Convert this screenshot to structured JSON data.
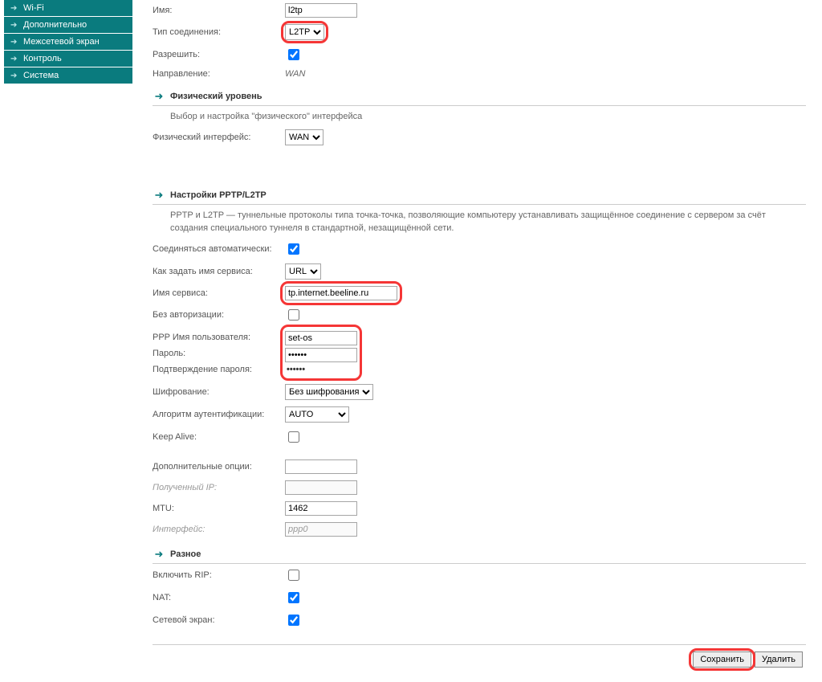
{
  "sidebar": {
    "items": [
      {
        "label": "Wi-Fi"
      },
      {
        "label": "Дополнительно"
      },
      {
        "label": "Межсетевой экран"
      },
      {
        "label": "Контроль"
      },
      {
        "label": "Система"
      }
    ]
  },
  "form": {
    "name_label": "Имя:",
    "name_value": "l2tp",
    "conn_type_label": "Тип соединения:",
    "conn_type_value": "L2TP",
    "allow_label": "Разрешить:",
    "direction_label": "Направление:",
    "direction_value": "WAN"
  },
  "section_phys": {
    "title": "Физический уровень",
    "desc": "Выбор и настройка \"физического\" интерфейса",
    "iface_label": "Физический интерфейс:",
    "iface_value": "WAN"
  },
  "section_pptp": {
    "title": "Настройки PPTP/L2TP",
    "desc": "PPTP и L2TP — туннельные протоколы типа точка-точка, позволяющие компьютеру устанавливать защищённое соединение с сервером за счёт создания специального туннеля в стандартной, незащищённой сети.",
    "auto_label": "Соединяться автоматически:",
    "service_mode_label": "Как задать имя сервиса:",
    "service_mode_value": "URL",
    "service_name_label": "Имя сервиса:",
    "service_name_value": "tp.internet.beeline.ru",
    "noauth_label": "Без авторизации:",
    "ppp_user_label": "PPP Имя пользователя:",
    "ppp_user_value": "set-os",
    "password_label": "Пароль:",
    "password_value": "••••••",
    "password_confirm_label": "Подтверждение пароля:",
    "password_confirm_value": "••••••",
    "encryption_label": "Шифрование:",
    "encryption_value": "Без шифрования",
    "auth_algo_label": "Алгоритм аутентификации:",
    "auth_algo_value": "AUTO",
    "keepalive_label": "Keep Alive:",
    "extra_opts_label": "Дополнительные опции:",
    "received_ip_label": "Полученный IP:",
    "mtu_label": "MTU:",
    "mtu_value": "1462",
    "interface_label": "Интерфейс:",
    "interface_value": "ppp0"
  },
  "section_misc": {
    "title": "Разное",
    "rip_label": "Включить RIP:",
    "nat_label": "NAT:",
    "firewall_label": "Сетевой экран:"
  },
  "buttons": {
    "save": "Сохранить",
    "delete": "Удалить"
  }
}
